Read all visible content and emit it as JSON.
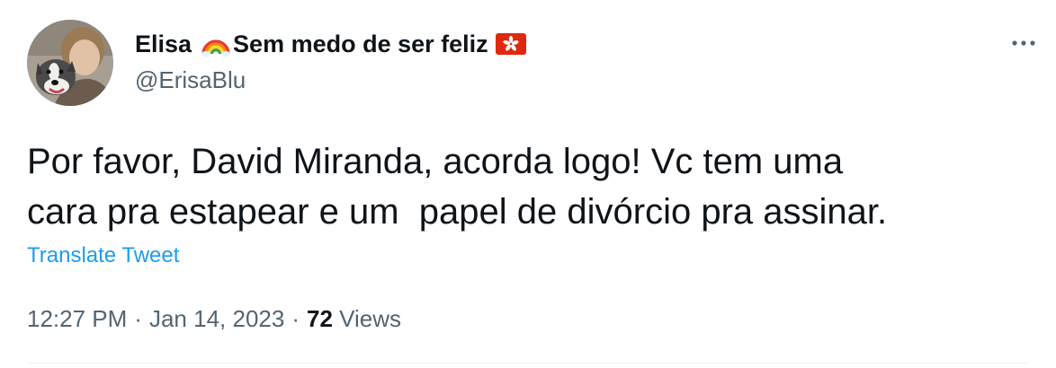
{
  "author": {
    "name_first": "Elisa",
    "name_rest": "Sem medo de ser feliz",
    "handle": "@ErisaBlu",
    "name_icons": [
      "rainbow-icon",
      "hong-kong-flag-icon"
    ]
  },
  "tweet": {
    "text": "Por favor, David Miranda, acorda logo! Vc tem uma\ncara pra estapear e um  papel de divórcio pra assinar.",
    "translate_label": "Translate Tweet",
    "time": "12:27 PM",
    "separator": "·",
    "date": "Jan 14, 2023",
    "views_count": "72",
    "views_label": "Views"
  },
  "colors": {
    "text": "#0f1419",
    "secondary": "#536471",
    "link": "#1d9bf0",
    "divider": "#eff3f4"
  }
}
